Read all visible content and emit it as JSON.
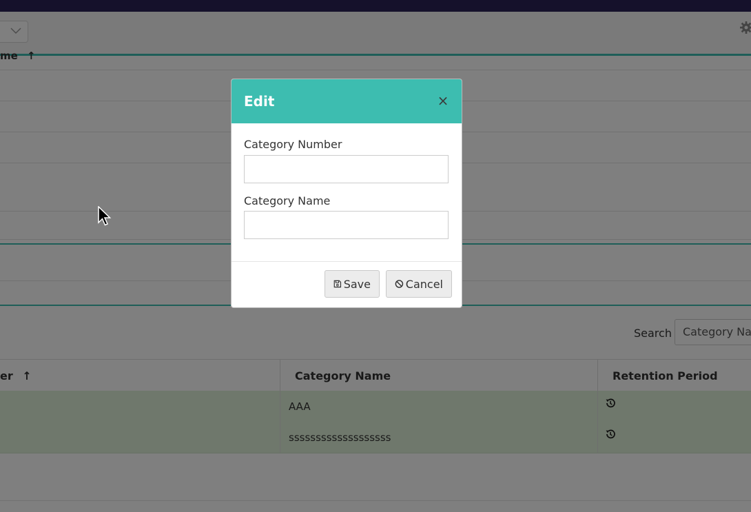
{
  "background": {
    "top_column_header": "me",
    "search": {
      "label": "Search",
      "placeholder": "Category Name"
    },
    "table": {
      "headers": [
        "er",
        "Category Name",
        "Retention Period"
      ],
      "sort_indicator": "↑",
      "rows": [
        {
          "number": "",
          "name": "AAA",
          "retention_icon": "history-icon"
        },
        {
          "number": "",
          "name": "sssssssssssssssssss",
          "retention_icon": "history-icon"
        }
      ]
    }
  },
  "modal": {
    "title": "Edit",
    "close_symbol": "×",
    "fields": [
      {
        "label": "Category Number",
        "value": ""
      },
      {
        "label": "Category Name",
        "value": ""
      }
    ],
    "save_label": "Save",
    "cancel_label": "Cancel"
  },
  "colors": {
    "accent": "#3dbdb0",
    "top_bar": "#2a2257",
    "row_highlight": "#dff0d8"
  }
}
